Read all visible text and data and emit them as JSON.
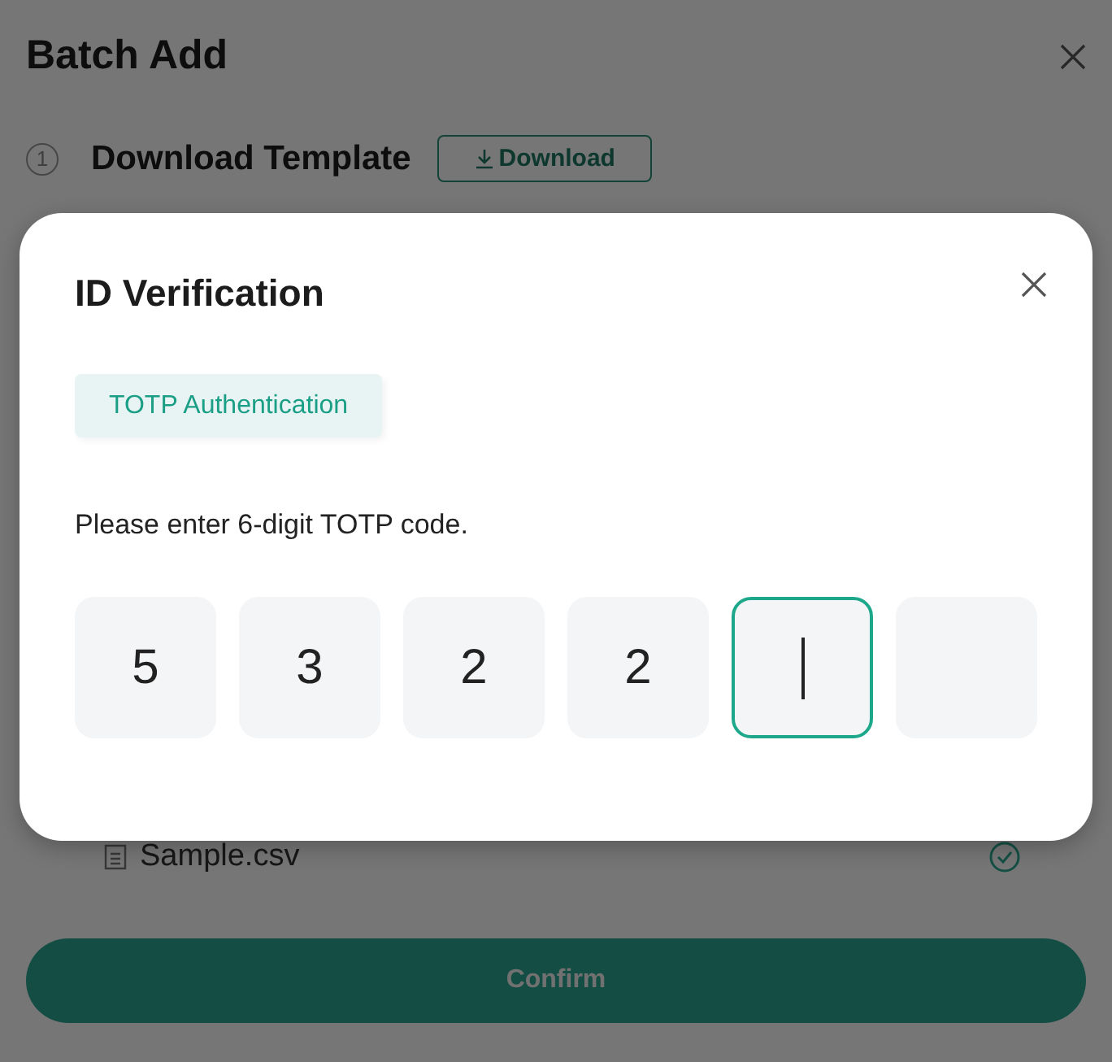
{
  "background": {
    "title": "Batch Add",
    "step": {
      "number": "1",
      "title": "Download Template",
      "button": "Download"
    },
    "file": {
      "name": "Sample.csv",
      "uploaded": true
    },
    "confirm_button": "Confirm"
  },
  "dialog": {
    "title": "ID Verification",
    "tabs": [
      {
        "label": "TOTP Authentication",
        "selected": true
      }
    ],
    "instruction": "Please enter 6-digit TOTP code.",
    "code_cells": [
      {
        "value": "5",
        "focused": false
      },
      {
        "value": "3",
        "focused": false
      },
      {
        "value": "2",
        "focused": false
      },
      {
        "value": "2",
        "focused": false
      },
      {
        "focused": true
      },
      {
        "focused": false
      }
    ]
  }
}
